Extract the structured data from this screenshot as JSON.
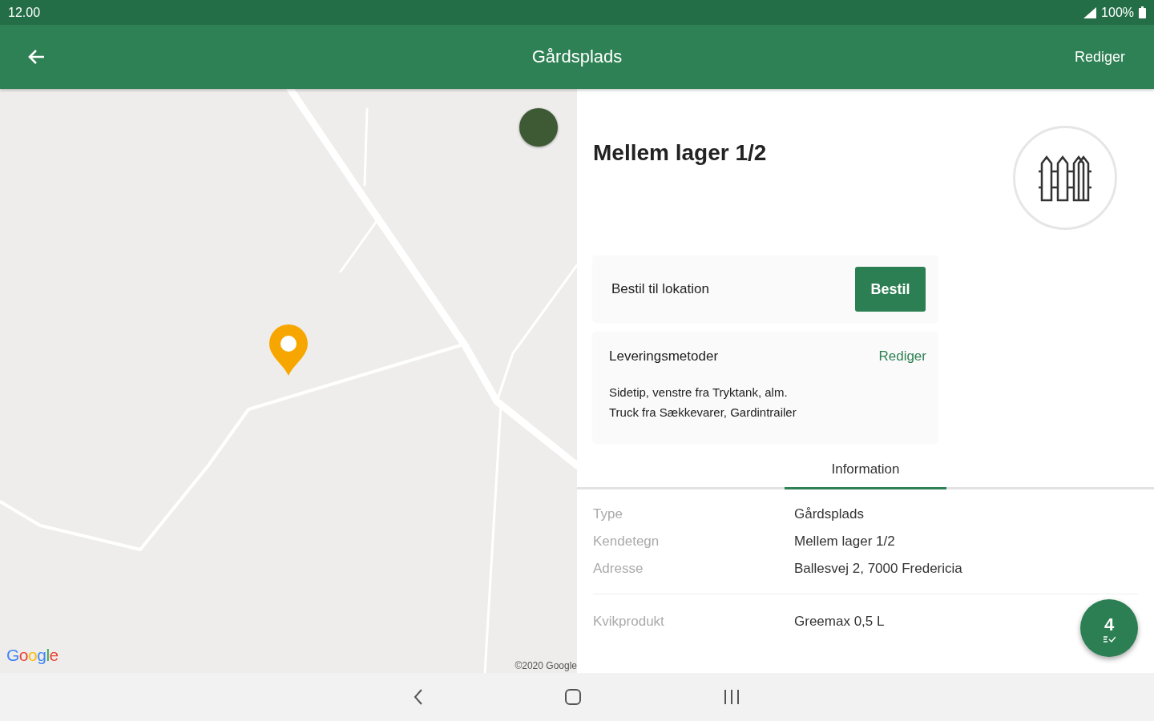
{
  "status_bar": {
    "time": "12.00",
    "battery": "100%"
  },
  "app_bar": {
    "title": "Gårdsplads",
    "action": "Rediger"
  },
  "map": {
    "logo": "Google",
    "attribution": "©2020 Google"
  },
  "location": {
    "title": "Mellem lager 1/2"
  },
  "order_card": {
    "label": "Bestil til lokation",
    "button": "Bestil"
  },
  "delivery_card": {
    "title": "Leveringsmetoder",
    "action": "Rediger",
    "lines": [
      "Sidetip, venstre fra Tryktank, alm.",
      "Truck fra Sækkevarer, Gardintrailer"
    ]
  },
  "tabs": [
    {
      "label": "Information",
      "selected": true
    }
  ],
  "info_rows": [
    {
      "label": "Type",
      "value": "Gårdsplads"
    },
    {
      "label": "Kendetegn",
      "value": "Mellem lager 1/2"
    },
    {
      "label": "Adresse",
      "value": "Ballesvej 2, 7000 Fredericia"
    }
  ],
  "quick_rows": [
    {
      "label": "Kvikprodukt",
      "value": "Greemax 0,5 L"
    }
  ],
  "fab": {
    "count": "4"
  }
}
